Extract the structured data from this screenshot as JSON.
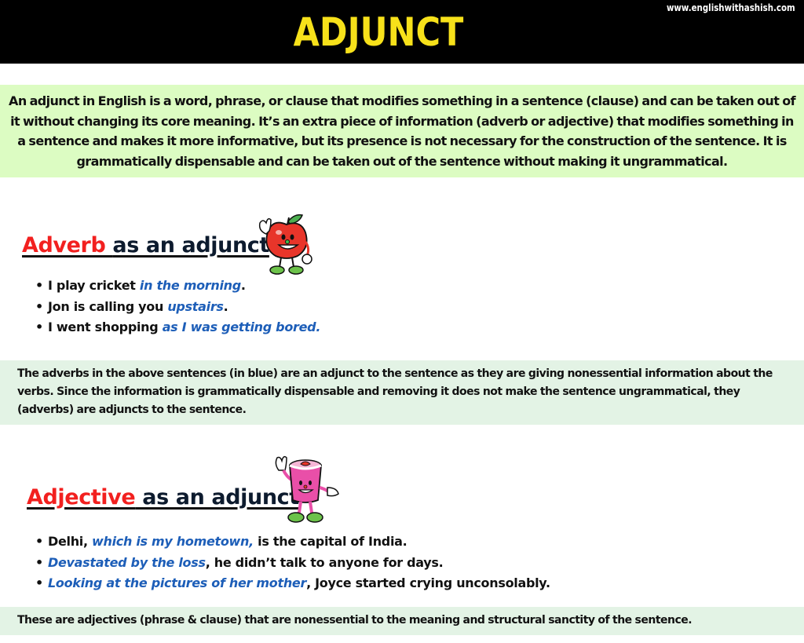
{
  "header": {
    "title": "ADJUNCT",
    "website": "www.englishwithashish.com",
    "colors": {
      "background": "#000000",
      "title": "#f7e11a",
      "website": "#ffffff"
    }
  },
  "intro": {
    "text": "An adjunct in English is a word, phrase, or clause that modifies something in a sentence (clause) and can be taken out of it without changing its core meaning. It’s an extra piece of information (adverb or adjective) that modifies something in a sentence and makes it more informative, but its presence is not necessary for the construction of the sentence. It is grammatically dispensable and can be taken out of the sentence without making it ungrammatical.",
    "background": "#dcfcc2"
  },
  "adverb_section": {
    "heading_highlight": "Adverb ",
    "heading_rest": "as an adjunct",
    "mascot": "apple-mascot-icon",
    "examples": [
      {
        "before": "I play cricket ",
        "adjunct": "in the morning",
        "after": "."
      },
      {
        "before": "Jon is calling you ",
        "adjunct": "upstairs",
        "after": "."
      },
      {
        "before": "I went shopping ",
        "adjunct": "as I was getting bored.",
        "after": ""
      }
    ],
    "note": "The adverbs in the above sentences (in blue) are an adjunct to the sentence as they are giving nonessential information about the verbs. Since the information is grammatically dispensable and removing it does not make the sentence ungrammatical, they (adverbs) are adjuncts to the sentence."
  },
  "adjective_section": {
    "heading_highlight": "Adjective",
    "heading_rest": " as an adjunct",
    "mascot": "yogurt-cup-mascot-icon",
    "examples": [
      {
        "before": "Delhi, ",
        "adjunct": "which is my hometown,",
        "after": " is the capital of India."
      },
      {
        "before": "",
        "adjunct": "Devastated by the loss",
        "after": ", he didn’t talk to anyone for days."
      },
      {
        "before": "",
        "adjunct": "Looking at the pictures of her mother",
        "after": ", Joyce started crying unconsolably."
      }
    ],
    "note": "These are adjectives (phrase & clause) that are nonessential to the meaning and structural sanctity of the sentence."
  },
  "colors": {
    "heading_red": "#f2201f",
    "heading_navy": "#0d1b2e",
    "adjunct_blue": "#1d5eb8",
    "note_background": "#e3f3e5"
  }
}
